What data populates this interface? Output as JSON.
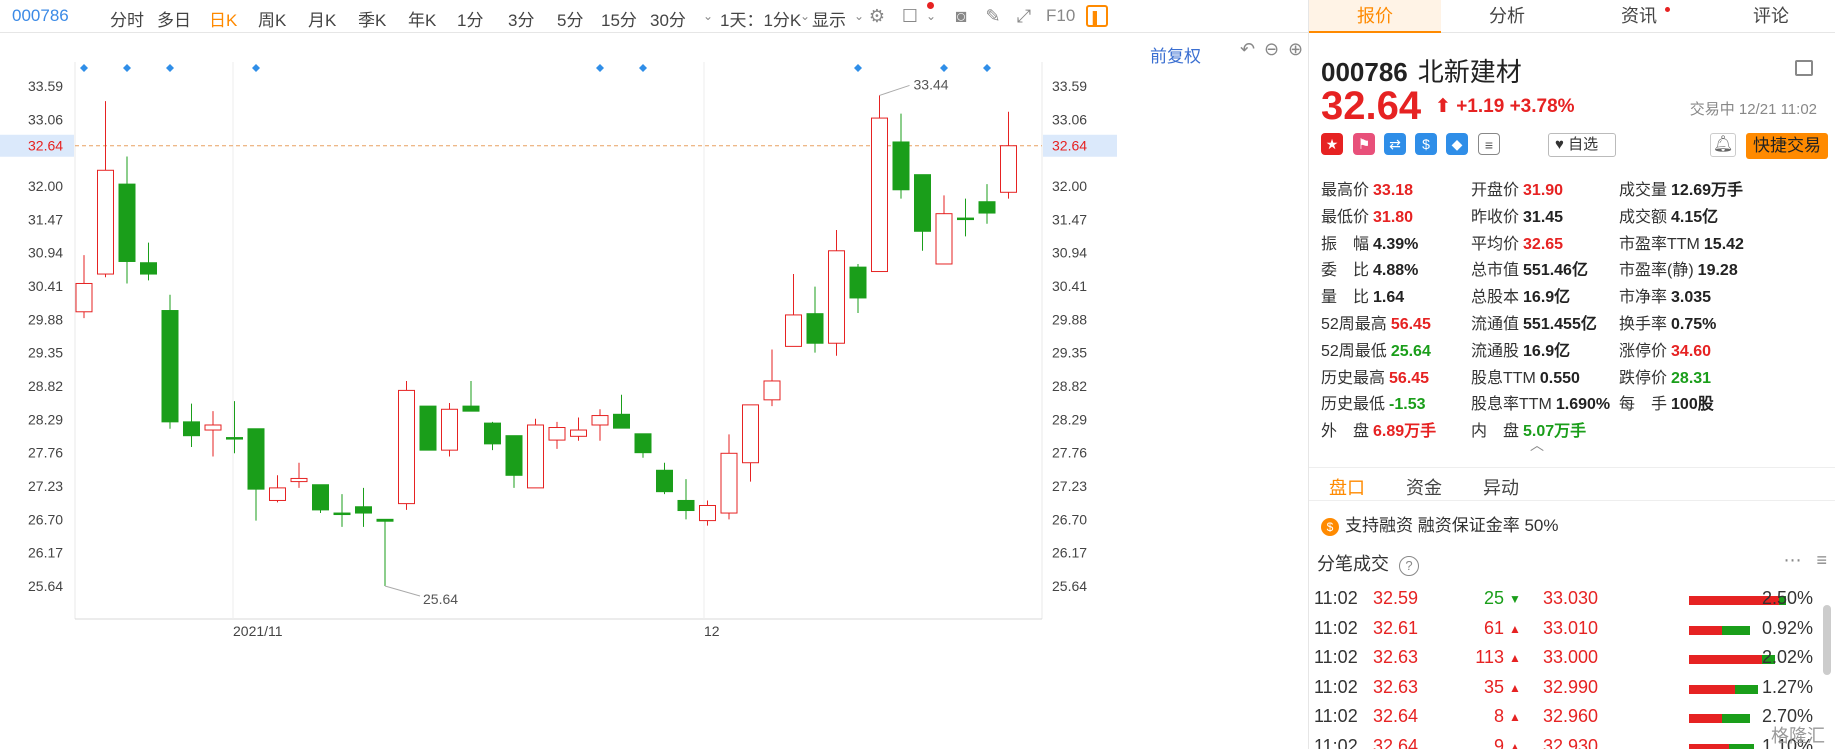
{
  "toolbar": {
    "code": "000786",
    "items": [
      "分时",
      "多日",
      "日K",
      "周K",
      "月K",
      "季K",
      "年K",
      "1分",
      "3分",
      "5分",
      "15分",
      "30分"
    ],
    "selected": "日K",
    "interval": "1天：1分K",
    "display": "显示",
    "f10": "F10"
  },
  "chart": {
    "fuquan": "前复权",
    "y_ticks": [
      "33.59",
      "33.06",
      "32.64",
      "32.00",
      "31.47",
      "30.94",
      "30.41",
      "29.88",
      "29.35",
      "28.82",
      "28.29",
      "27.76",
      "27.23",
      "26.70",
      "26.17",
      "25.64"
    ],
    "current_line": "32.64",
    "x_labels": [
      "2021/11",
      "12"
    ],
    "max_label": "33.44",
    "min_label": "25.64"
  },
  "chart_data": {
    "type": "candlestick",
    "current_price": 32.64,
    "ylim": [
      25.2,
      34.2
    ],
    "candles": [
      {
        "o": 30.0,
        "c": 30.45,
        "h": 30.9,
        "l": 29.9
      },
      {
        "o": 30.6,
        "c": 32.25,
        "h": 33.35,
        "l": 30.55
      },
      {
        "o": 32.03,
        "c": 30.8,
        "h": 32.47,
        "l": 30.45
      },
      {
        "o": 30.78,
        "c": 30.6,
        "h": 31.1,
        "l": 30.5
      },
      {
        "o": 30.02,
        "c": 28.25,
        "h": 30.27,
        "l": 28.14
      },
      {
        "o": 28.25,
        "c": 28.03,
        "h": 28.54,
        "l": 27.85
      },
      {
        "o": 28.12,
        "c": 28.2,
        "h": 28.42,
        "l": 27.7
      },
      {
        "o": 28.0,
        "c": 27.98,
        "h": 28.58,
        "l": 27.75
      },
      {
        "o": 28.14,
        "c": 27.18,
        "h": 28.14,
        "l": 26.68
      },
      {
        "o": 27.0,
        "c": 27.2,
        "h": 27.4,
        "l": 26.97
      },
      {
        "o": 27.3,
        "c": 27.35,
        "h": 27.6,
        "l": 27.2
      },
      {
        "o": 27.25,
        "c": 26.85,
        "h": 27.25,
        "l": 26.8
      },
      {
        "o": 26.8,
        "c": 26.78,
        "h": 27.1,
        "l": 26.58
      },
      {
        "o": 26.9,
        "c": 26.8,
        "h": 27.2,
        "l": 26.58
      },
      {
        "o": 26.7,
        "c": 26.67,
        "h": 26.7,
        "l": 25.64
      },
      {
        "o": 26.95,
        "c": 28.75,
        "h": 28.9,
        "l": 26.85
      },
      {
        "o": 28.5,
        "c": 27.8,
        "h": 28.5,
        "l": 27.8
      },
      {
        "o": 27.8,
        "c": 28.45,
        "h": 28.55,
        "l": 27.7
      },
      {
        "o": 28.5,
        "c": 28.42,
        "h": 28.9,
        "l": 28.42
      },
      {
        "o": 28.23,
        "c": 27.9,
        "h": 28.25,
        "l": 27.8
      },
      {
        "o": 28.03,
        "c": 27.4,
        "h": 28.03,
        "l": 27.2
      },
      {
        "o": 27.2,
        "c": 28.2,
        "h": 28.3,
        "l": 27.2
      },
      {
        "o": 27.96,
        "c": 28.16,
        "h": 28.25,
        "l": 27.82
      },
      {
        "o": 28.02,
        "c": 28.12,
        "h": 28.32,
        "l": 27.95
      },
      {
        "o": 28.2,
        "c": 28.35,
        "h": 28.45,
        "l": 27.95
      },
      {
        "o": 28.37,
        "c": 28.15,
        "h": 28.68,
        "l": 28.15
      },
      {
        "o": 28.06,
        "c": 27.76,
        "h": 28.06,
        "l": 27.68
      },
      {
        "o": 27.48,
        "c": 27.14,
        "h": 27.6,
        "l": 27.1
      },
      {
        "o": 27.0,
        "c": 26.84,
        "h": 27.34,
        "l": 26.7
      },
      {
        "o": 26.68,
        "c": 26.92,
        "h": 27.0,
        "l": 26.6
      },
      {
        "o": 26.8,
        "c": 27.75,
        "h": 28.05,
        "l": 26.7
      },
      {
        "o": 27.6,
        "c": 28.52,
        "h": 28.52,
        "l": 27.3
      },
      {
        "o": 28.6,
        "c": 28.9,
        "h": 29.4,
        "l": 28.5
      },
      {
        "o": 29.45,
        "c": 29.95,
        "h": 30.6,
        "l": 29.45
      },
      {
        "o": 29.97,
        "c": 29.5,
        "h": 30.4,
        "l": 29.35
      },
      {
        "o": 29.5,
        "c": 30.97,
        "h": 31.3,
        "l": 29.3
      },
      {
        "o": 30.71,
        "c": 30.22,
        "h": 30.76,
        "l": 29.98
      },
      {
        "o": 30.64,
        "c": 33.08,
        "h": 33.44,
        "l": 30.64
      },
      {
        "o": 32.7,
        "c": 31.94,
        "h": 33.15,
        "l": 31.8
      },
      {
        "o": 32.18,
        "c": 31.28,
        "h": 32.18,
        "l": 30.97
      },
      {
        "o": 30.76,
        "c": 31.56,
        "h": 31.85,
        "l": 30.76
      },
      {
        "o": 31.49,
        "c": 31.47,
        "h": 31.8,
        "l": 31.2
      },
      {
        "o": 31.75,
        "c": 31.57,
        "h": 32.03,
        "l": 31.4
      },
      {
        "o": 31.9,
        "c": 32.64,
        "h": 33.18,
        "l": 31.8
      }
    ],
    "markers_candle_index": [
      0,
      2,
      4,
      8,
      24,
      26,
      36,
      40,
      42
    ]
  },
  "tabs": [
    "报价",
    "分析",
    "资讯",
    "评论"
  ],
  "stock": {
    "code": "000786",
    "name": "北新建材",
    "price": "32.64",
    "arrow": "⬆",
    "change": "+1.19",
    "pct": "+3.78%",
    "status": "交易中 12/21 11:02",
    "zixuan": "自选",
    "quick": "快捷交易"
  },
  "stats": [
    [
      {
        "k": "最高价",
        "v": "33.18",
        "c": "red"
      },
      {
        "k": "开盘价",
        "v": "31.90",
        "c": "red"
      },
      {
        "k": "成交量",
        "v": "12.69万手",
        "c": "blk"
      }
    ],
    [
      {
        "k": "最低价",
        "v": "31.80",
        "c": "red"
      },
      {
        "k": "昨收价",
        "v": "31.45",
        "c": "blk"
      },
      {
        "k": "成交额",
        "v": "4.15亿",
        "c": "blk"
      }
    ],
    [
      {
        "k": "振　幅",
        "v": "4.39%",
        "c": "blk"
      },
      {
        "k": "平均价",
        "v": "32.65",
        "c": "red"
      },
      {
        "k": "市盈率TTM",
        "v": "15.42",
        "c": "blk"
      }
    ],
    [
      {
        "k": "委　比",
        "v": "4.88%",
        "c": "blk"
      },
      {
        "k": "总市值",
        "v": "551.46亿",
        "c": "blk"
      },
      {
        "k": "市盈率(静)",
        "v": "19.28",
        "c": "blk"
      }
    ],
    [
      {
        "k": "量　比",
        "v": "1.64",
        "c": "blk"
      },
      {
        "k": "总股本",
        "v": "16.9亿",
        "c": "blk"
      },
      {
        "k": "市净率",
        "v": "3.035",
        "c": "blk"
      }
    ],
    [
      {
        "k": "52周最高",
        "v": "56.45",
        "c": "red"
      },
      {
        "k": "流通值",
        "v": "551.455亿",
        "c": "blk"
      },
      {
        "k": "换手率",
        "v": "0.75%",
        "c": "blk"
      }
    ],
    [
      {
        "k": "52周最低",
        "v": "25.64",
        "c": "green"
      },
      {
        "k": "流通股",
        "v": "16.9亿",
        "c": "blk"
      },
      {
        "k": "涨停价",
        "v": "34.60",
        "c": "red"
      }
    ],
    [
      {
        "k": "历史最高",
        "v": "56.45",
        "c": "red"
      },
      {
        "k": "股息TTM",
        "v": "0.550",
        "c": "blk"
      },
      {
        "k": "跌停价",
        "v": "28.31",
        "c": "green"
      }
    ],
    [
      {
        "k": "历史最低",
        "v": "-1.53",
        "c": "green"
      },
      {
        "k": "股息率TTM",
        "v": "1.690%",
        "c": "blk"
      },
      {
        "k": "每　手",
        "v": "100股",
        "c": "blk"
      }
    ],
    [
      {
        "k": "外　盘",
        "v": "6.89万手",
        "c": "red"
      },
      {
        "k": "内　盘",
        "v": "5.07万手",
        "c": "green"
      },
      {
        "k": "",
        "v": "",
        "c": "blk"
      }
    ]
  ],
  "subtabs": [
    "盘口",
    "资金",
    "异动"
  ],
  "margin": "支持融资 融资保证金率 50%",
  "trades_title": "分笔成交",
  "trades": [
    {
      "t": "11:02",
      "p": "32.59",
      "v": "25",
      "d": "down",
      "bp": "33.030",
      "pc": "2.50%",
      "r": 0.82
    },
    {
      "t": "11:02",
      "p": "32.61",
      "v": "61",
      "d": "up",
      "bp": "33.010",
      "pc": "0.92%",
      "r": 0.3
    },
    {
      "t": "11:02",
      "p": "32.63",
      "v": "113",
      "d": "up",
      "bp": "33.000",
      "pc": "2.02%",
      "r": 0.66
    },
    {
      "t": "11:02",
      "p": "32.63",
      "v": "35",
      "d": "up",
      "bp": "32.990",
      "pc": "1.27%",
      "r": 0.42
    },
    {
      "t": "11:02",
      "p": "32.64",
      "v": "8",
      "d": "up",
      "bp": "32.960",
      "pc": "2.70%",
      "r": 0.3
    },
    {
      "t": "11:02",
      "p": "32.64",
      "v": "9",
      "d": "up",
      "bp": "32.930",
      "pc": "1.10%",
      "r": 0.36
    }
  ],
  "watermark": "格隆汇"
}
